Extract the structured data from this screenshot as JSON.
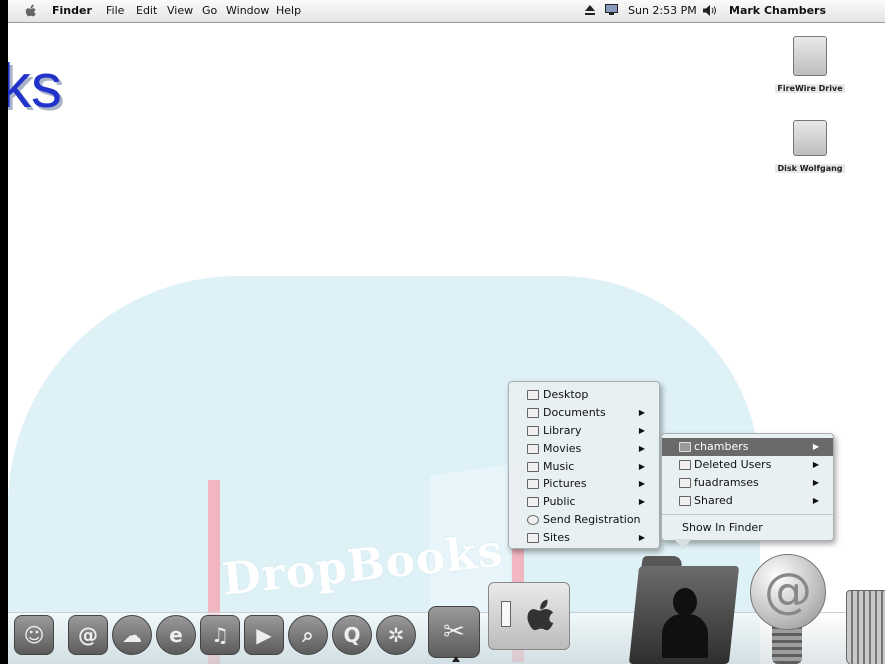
{
  "menubar": {
    "app_name": "Finder",
    "menus": [
      "File",
      "Edit",
      "View",
      "Go",
      "Window",
      "Help"
    ],
    "clock": "Sun 2:53 PM",
    "user": "Mark Chambers",
    "icons": [
      "apple-menu-icon",
      "eject-icon",
      "display-icon",
      "volume-icon"
    ]
  },
  "watermark": {
    "brand": "DropBooks",
    "fragment": "ks"
  },
  "desktop": {
    "icons": [
      {
        "label": "FireWire Drive",
        "icon": "firewire-drive-icon"
      },
      {
        "label": "Disk Wolfgang",
        "icon": "hard-disk-icon"
      }
    ]
  },
  "home_menu": {
    "items": [
      {
        "label": "Desktop",
        "icon": "desktop-folder-icon",
        "submenu": false
      },
      {
        "label": "Documents",
        "icon": "documents-folder-icon",
        "submenu": true
      },
      {
        "label": "Library",
        "icon": "library-folder-icon",
        "submenu": true
      },
      {
        "label": "Movies",
        "icon": "movies-folder-icon",
        "submenu": true
      },
      {
        "label": "Music",
        "icon": "music-folder-icon",
        "submenu": true
      },
      {
        "label": "Pictures",
        "icon": "pictures-folder-icon",
        "submenu": true
      },
      {
        "label": "Public",
        "icon": "public-folder-icon",
        "submenu": true
      },
      {
        "label": "Send Registration",
        "icon": "registration-icon",
        "submenu": false
      },
      {
        "label": "Sites",
        "icon": "sites-folder-icon",
        "submenu": true
      }
    ]
  },
  "users_menu": {
    "items": [
      {
        "label": "chambers",
        "icon": "home-icon",
        "submenu": true,
        "highlighted": true
      },
      {
        "label": "Deleted Users",
        "icon": "folder-icon",
        "submenu": true
      },
      {
        "label": "fuadramses",
        "icon": "folder-icon",
        "submenu": true
      },
      {
        "label": "Shared",
        "icon": "folder-icon",
        "submenu": true
      }
    ],
    "show_in_finder": "Show In Finder"
  },
  "dock": {
    "items": [
      "finder-icon",
      "address-book-icon",
      "ichat-icon",
      "internet-explorer-icon",
      "itunes-icon",
      "imovie-icon",
      "sherlock-icon",
      "quicktime-icon",
      "safari-icon",
      "preview-icon",
      "system-preferences-icon",
      "home-folder-icon",
      "mail-icon",
      "trash-icon"
    ]
  },
  "colors": {
    "menu_highlight": "#6a6a6a",
    "watermark_blue": "#2233cc",
    "watermark_bg": "#d8eef5"
  }
}
